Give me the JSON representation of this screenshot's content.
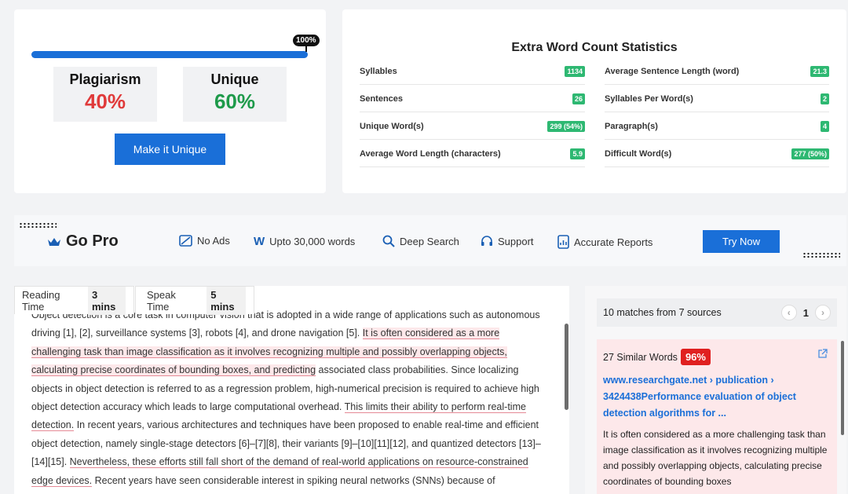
{
  "plagiarism": {
    "progress_label": "100%",
    "progress_fraction": 1.0,
    "plagiarism_label": "Plagiarism",
    "plagiarism_value": "40%",
    "unique_label": "Unique",
    "unique_value": "60%",
    "button_label": "Make it Unique",
    "colors": {
      "plagiarism": "#e03a3a",
      "unique": "#1e9a4a",
      "accent": "#1a6fd8"
    }
  },
  "stats": {
    "title": "Extra Word Count Statistics",
    "left": [
      {
        "label": "Syllables",
        "value": "1134"
      },
      {
        "label": "Sentences",
        "value": "26"
      },
      {
        "label": "Unique Word(s)",
        "value": "299 (54%)"
      },
      {
        "label": "Average Word Length (characters)",
        "value": "5.9"
      }
    ],
    "right": [
      {
        "label": "Average Sentence Length (word)",
        "value": "21.3"
      },
      {
        "label": "Syllables Per Word(s)",
        "value": "2"
      },
      {
        "label": "Paragraph(s)",
        "value": "4"
      },
      {
        "label": "Difficult Word(s)",
        "value": "277 (50%)"
      }
    ]
  },
  "gopro": {
    "title": "Go Pro",
    "features": [
      {
        "icon": "no-ads-icon",
        "label": "No Ads"
      },
      {
        "icon": "words-icon",
        "label": "Upto 30,000 words"
      },
      {
        "icon": "search-icon",
        "label": "Deep Search"
      },
      {
        "icon": "headset-icon",
        "label": "Support"
      },
      {
        "icon": "report-icon",
        "label": "Accurate Reports"
      }
    ],
    "cta": "Try Now"
  },
  "reading": {
    "reading_time_label": "Reading Time",
    "reading_time_value": "3 mins",
    "speak_time_label": "Speak Time",
    "speak_time_value": "5 mins",
    "text": {
      "s0": "Object detection is a core task in computer vision that is adopted in a wide range of applications such as autonomous driving [1], [2], surveillance systems [3], robots [4], and drone navigation [5]. ",
      "s1": "It is often considered as a more challenging task than image classification as it involves recognizing multiple and possibly overlapping objects, calculating precise coordinates of bounding boxes, and predicting",
      "s2": " associated class probabilities. Since localizing objects in object detection is referred to as a regression problem, high-numerical precision is required to achieve high object detection accuracy which leads to large computational overhead. ",
      "s3": "This limits their ability to perform real-time detection.",
      "s4": " In recent years, various architectures and techniques have been proposed to enable real-time and efficient object detection, namely single-stage detectors [6]–[7][8], their variants [9]–[10][11][12], and quantized detectors [13]–[14][15]. ",
      "s5": "Nevertheless, these efforts still fall short of the demand of real-world applications on resource-constrained edge devices.",
      "s6": " Recent years have seen considerable interest in spiking neural networks (SNNs) because of"
    }
  },
  "matches": {
    "summary": "10 matches from 7 sources",
    "page": "1",
    "prev": "‹",
    "next": "›",
    "card": {
      "similar_words": "27 Similar Words",
      "percent": "96%",
      "source_title": "www.researchgate.net › publication › 3424438Performance evaluation of object detection algorithms for ...",
      "excerpt": "It is often considered as a more challenging task than image classification as it involves recognizing multiple and possibly overlapping objects, calculating precise coordinates of bounding boxes"
    }
  }
}
